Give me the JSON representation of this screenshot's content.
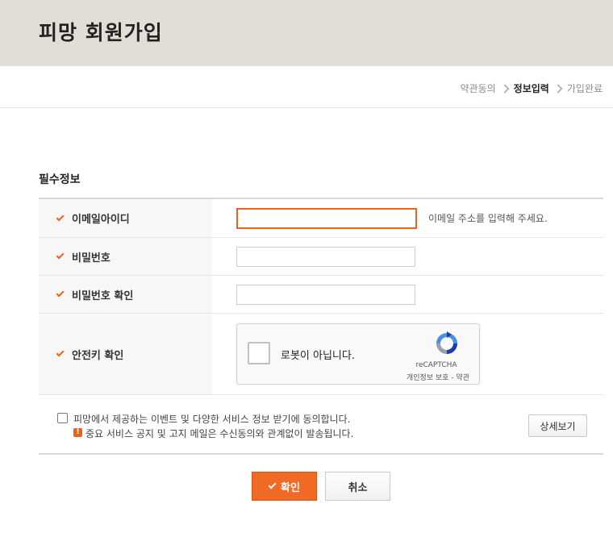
{
  "page": {
    "title": "피망 회원가입"
  },
  "steps": [
    {
      "label": "약관동의",
      "active": false
    },
    {
      "label": "정보입력",
      "active": true
    },
    {
      "label": "가입완료",
      "active": false
    }
  ],
  "section": {
    "title": "필수정보"
  },
  "fields": {
    "email": {
      "label": "이메일아이디",
      "value": "",
      "hint": "이메일 주소를 입력해 주세요."
    },
    "password": {
      "label": "비밀번호",
      "value": ""
    },
    "password_confirm": {
      "label": "비밀번호 확인",
      "value": ""
    },
    "security_key": {
      "label": "안전키 확인"
    }
  },
  "recaptcha": {
    "label": "로봇이 아닙니다.",
    "brand": "reCAPTCHA",
    "links": "개인정보 보호 - 약관"
  },
  "consent": {
    "checked": false,
    "text": "피망에서 제공하는 이벤트 및 다양한 서비스 정보 받기에 동의합니다.",
    "notice": "중요 서비스 공지 및 고지 메일은 수신동의와 관계없이 발송됩니다.",
    "notice_icon": "!",
    "detail_button": "상세보기"
  },
  "buttons": {
    "confirm": "확인",
    "cancel": "취소"
  },
  "colors": {
    "accent": "#ef6a24",
    "header_bg": "#e2ddd5"
  }
}
